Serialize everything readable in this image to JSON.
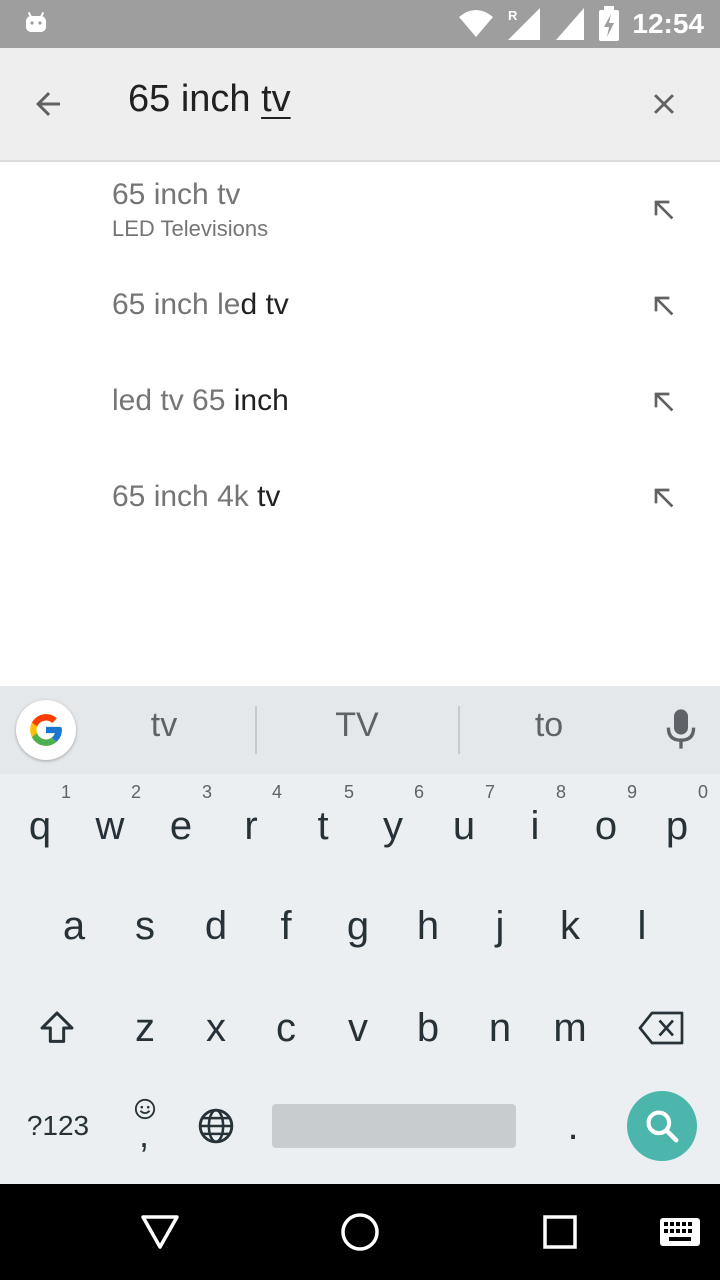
{
  "status_bar": {
    "time": "12:54",
    "icons": [
      "android-icon",
      "wifi-icon",
      "signal-roaming-icon",
      "signal-icon",
      "battery-charging-icon"
    ],
    "roaming_label": "R"
  },
  "search": {
    "query_prefix": "65 inch ",
    "query_composing": "tv"
  },
  "suggestions": [
    {
      "muted": "65 inch tv",
      "strong": "",
      "subtitle": "LED Televisions"
    },
    {
      "muted": "65 inch le",
      "strong": "d tv",
      "subtitle": ""
    },
    {
      "muted": "led tv 65 ",
      "strong": "inch",
      "subtitle": ""
    },
    {
      "muted": "65 inch 4k ",
      "strong": "tv",
      "subtitle": ""
    }
  ],
  "keyboard": {
    "predictions": [
      "tv",
      "TV",
      "to"
    ],
    "row1": [
      {
        "key": "q",
        "hint": "1"
      },
      {
        "key": "w",
        "hint": "2"
      },
      {
        "key": "e",
        "hint": "3"
      },
      {
        "key": "r",
        "hint": "4"
      },
      {
        "key": "t",
        "hint": "5"
      },
      {
        "key": "y",
        "hint": "6"
      },
      {
        "key": "u",
        "hint": "7"
      },
      {
        "key": "i",
        "hint": "8"
      },
      {
        "key": "o",
        "hint": "9"
      },
      {
        "key": "p",
        "hint": "0"
      }
    ],
    "row2": [
      "a",
      "s",
      "d",
      "f",
      "g",
      "h",
      "j",
      "k",
      "l"
    ],
    "row3": [
      "z",
      "x",
      "c",
      "v",
      "b",
      "n",
      "m"
    ],
    "symbols_label": "?123",
    "comma": ",",
    "period": "."
  },
  "colors": {
    "accent": "#4db6ac",
    "status_bar": "#9e9e9e",
    "search_bar": "#eeeeee",
    "keyboard": "#eceff1"
  }
}
